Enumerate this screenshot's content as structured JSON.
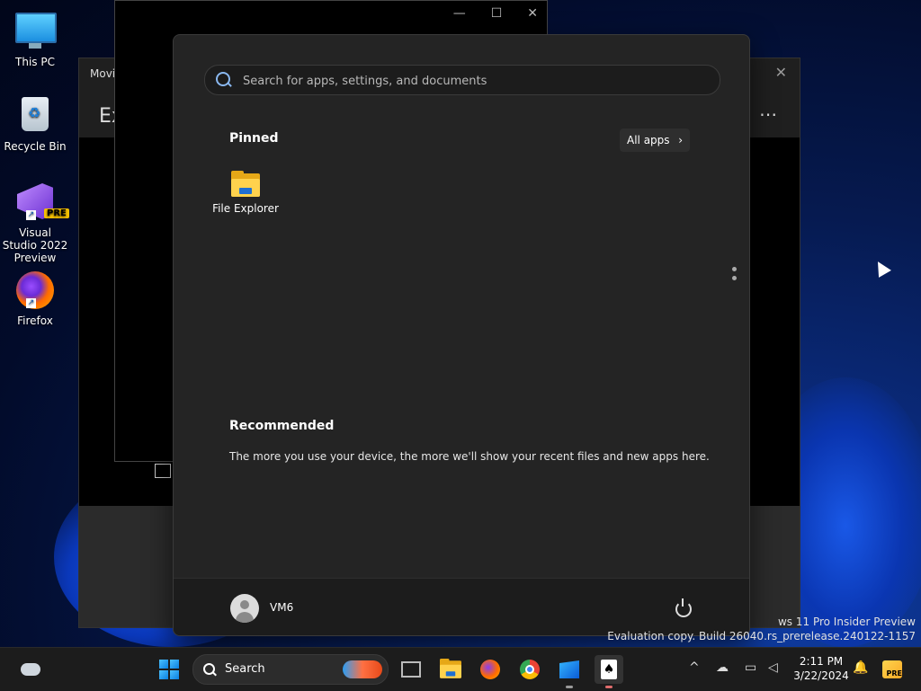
{
  "desktop": {
    "icons": [
      {
        "label": "This PC"
      },
      {
        "label": "Recycle Bin"
      },
      {
        "label": "Visual Studio 2022 Preview",
        "badge": "PRE"
      },
      {
        "label": "Firefox"
      }
    ]
  },
  "movie_window": {
    "title": "Movi",
    "heading": "Ex",
    "close_glyph": "✕",
    "more_glyph": "⋯"
  },
  "black_window": {
    "minimize_glyph": "—",
    "maximize_glyph": "☐",
    "close_glyph": "✕"
  },
  "start_menu": {
    "search": {
      "placeholder": "Search for apps, settings, and documents"
    },
    "pinned": {
      "label": "Pinned",
      "all_apps_label": "All apps",
      "all_apps_chevron": "›",
      "apps": [
        {
          "label": "File Explorer",
          "icon": "folder-icon"
        }
      ]
    },
    "recommended": {
      "label": "Recommended",
      "text": "The more you use your device, the more we'll show your recent files and new apps here."
    },
    "footer": {
      "username": "VM6"
    }
  },
  "watermark": {
    "line1": "ws 11 Pro Insider Preview",
    "line2": "Evaluation copy. Build 26040.rs_prerelease.240122-1157"
  },
  "taskbar": {
    "search_label": "Search",
    "tray": {
      "chevron": "^",
      "notification_glyph": "🔔"
    },
    "clock": {
      "time": "2:11 PM",
      "date": "3/22/2024"
    },
    "pre_badge": "PRE"
  },
  "colors": {
    "start_bg": "#242424",
    "taskbar_bg": "#1c1c1c",
    "accent": "#4cc2ff",
    "folder": "#ffd24d"
  }
}
